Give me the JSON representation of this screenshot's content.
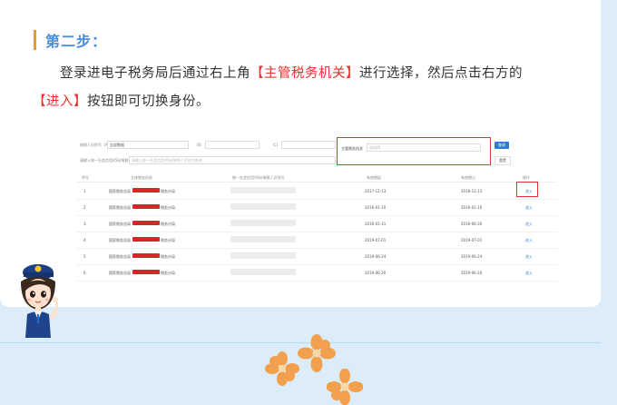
{
  "step": {
    "title": "第二步："
  },
  "paragraph": {
    "part1": "登录进电子税务局后通过右上角",
    "highlight1": "【主管税务机关】",
    "part2": "进行选择，然后点击右方的",
    "highlight2": "【进入】",
    "part3": "按钮即可切换身份。"
  },
  "screenshot": {
    "filters": {
      "label1": "纳税人识别号（A）",
      "value1": "全部数据",
      "label2": "（B）",
      "label3": "（C）",
      "long_label": "请输入统一社会信用代码/纳税人识别号",
      "long_placeholder": "请输入统一社会信用代码/纳税人识别号查询"
    },
    "tax_authority": {
      "label": "主管税务机关",
      "placeholder": "请选择"
    },
    "query_button": "查询",
    "reset_button": "重置",
    "columns": [
      "序号",
      "主体税务机关",
      "统一社会信用代码/纳税人识别号",
      "有效期起",
      "有效期止",
      "操作"
    ],
    "rows": [
      {
        "no": "1",
        "name_left": "国家税务总局",
        "name_right": "税务分局",
        "start": "2017-12-13",
        "end": "2018-12-13",
        "action": "进入"
      },
      {
        "no": "2",
        "name_left": "国家税务总局",
        "name_right": "税务分局",
        "start": "2016-01-10",
        "end": "2016-01-10",
        "action": "进入"
      },
      {
        "no": "3",
        "name_left": "国家税务总局",
        "name_right": "税务分局",
        "start": "2016-01-31",
        "end": "2016-06-30",
        "action": "进入"
      },
      {
        "no": "4",
        "name_left": "国家税务总局",
        "name_right": "税务分局",
        "start": "2019-07-01",
        "end": "2019-07-01",
        "action": "进入"
      },
      {
        "no": "5",
        "name_left": "国家税务总局",
        "name_right": "税务分局",
        "start": "2019-06-24",
        "end": "2019-06-24",
        "action": "进入"
      },
      {
        "no": "6",
        "name_left": "国家税务总局",
        "name_right": "税务分局",
        "start": "2019-06-20",
        "end": "2019-06-20",
        "action": "进入"
      }
    ]
  },
  "colors": {
    "accent": "#4a8fd8",
    "highlight": "#e8302d",
    "bar": "#e9963e",
    "background": "#dcedf9"
  }
}
